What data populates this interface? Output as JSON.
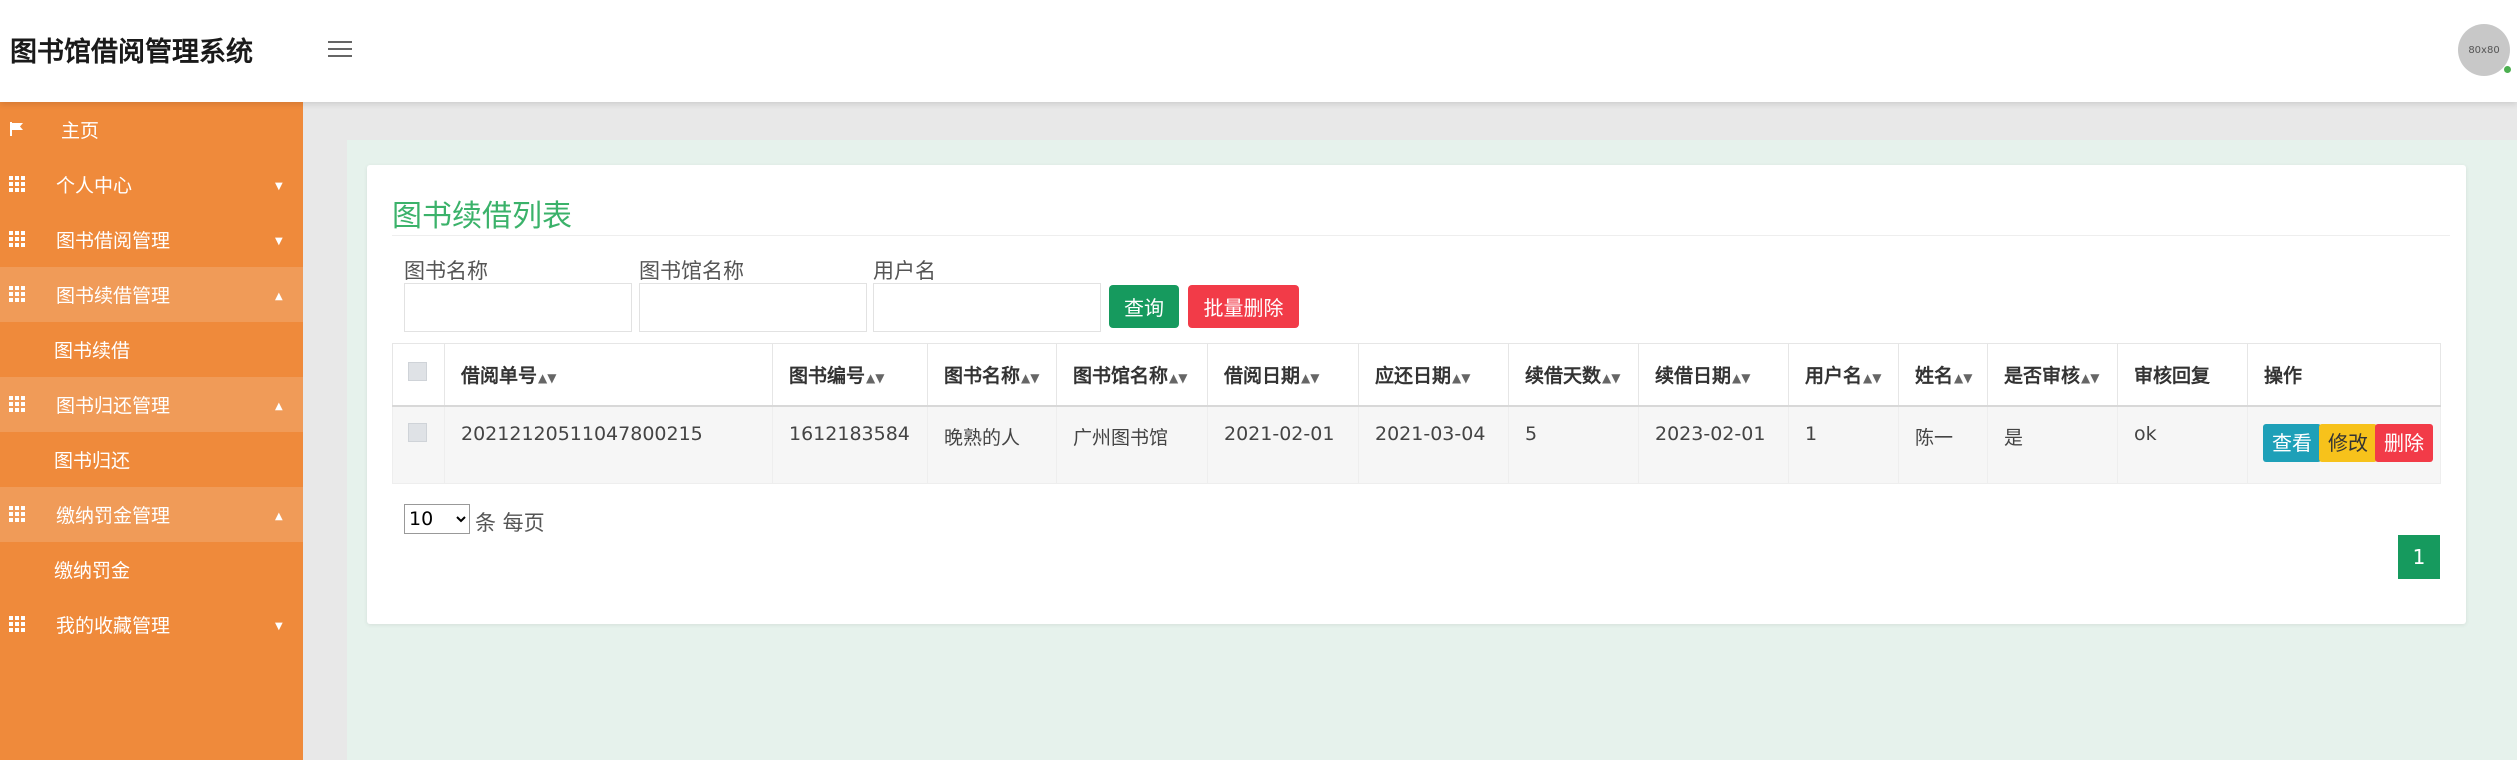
{
  "header": {
    "app_title": "图书馆借阅管理系统",
    "menu_icon": "hamburger-icon",
    "avatar_text": "80x80"
  },
  "sidebar": {
    "home": "主页",
    "items": [
      {
        "label": "个人中心",
        "expanded": false
      },
      {
        "label": "图书借阅管理",
        "expanded": false
      },
      {
        "label": "图书续借管理",
        "expanded": true,
        "children": [
          "图书续借"
        ]
      },
      {
        "label": "图书归还管理",
        "expanded": true,
        "children": [
          "图书归还"
        ]
      },
      {
        "label": "缴纳罚金管理",
        "expanded": true,
        "children": [
          "缴纳罚金"
        ]
      },
      {
        "label": "我的收藏管理",
        "expanded": false
      }
    ]
  },
  "page": {
    "title": "图书续借列表",
    "filters": [
      {
        "label": "图书名称",
        "value": ""
      },
      {
        "label": "图书馆名称",
        "value": ""
      },
      {
        "label": "用户名",
        "value": ""
      }
    ],
    "query_button": "查询",
    "bulk_delete_button": "批量删除"
  },
  "table": {
    "headers": [
      "借阅单号",
      "图书编号",
      "图书名称",
      "图书馆名称",
      "借阅日期",
      "应还日期",
      "续借天数",
      "续借日期",
      "用户名",
      "姓名",
      "是否审核",
      "审核回复",
      "操作"
    ],
    "sortable": [
      true,
      true,
      true,
      true,
      true,
      true,
      true,
      true,
      true,
      true,
      true,
      false,
      false
    ],
    "rows": [
      [
        "20212120511047800215",
        "1612183584",
        "晚熟的人",
        "广州图书馆",
        "2021-02-01",
        "2021-03-04",
        "5",
        "2023-02-01",
        "1",
        "陈一",
        "是",
        "ok"
      ]
    ],
    "actions": {
      "view": "查看",
      "edit": "修改",
      "delete": "删除"
    }
  },
  "pagination": {
    "page_size": "10",
    "page_size_options": [
      "10"
    ],
    "page_size_suffix": "条 每页",
    "current_page": "1"
  },
  "colors": {
    "sidebar": "#ef8a3b",
    "accent_green": "#169a5e",
    "title_green": "#3bb26a",
    "danger": "#f23b48",
    "info": "#1ea0b8",
    "warning": "#f7c21b"
  }
}
